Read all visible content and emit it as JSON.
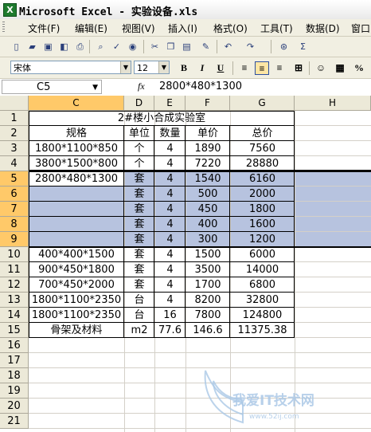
{
  "window": {
    "title": "Microsoft Excel - 实验设备.xls",
    "app_icon": "excel-icon"
  },
  "menu": [
    "文件(F)",
    "编辑(E)",
    "视图(V)",
    "插入(I)",
    "格式(O)",
    "工具(T)",
    "数据(D)",
    "窗口"
  ],
  "toolbar_icons": [
    "new-icon",
    "open-icon",
    "save-icon",
    "permission-icon",
    "print-icon",
    "print-preview-icon",
    "spelling-icon",
    "research-icon",
    "cut-icon",
    "copy-icon",
    "paste-icon",
    "format-painter-icon",
    "undo-icon",
    "redo-icon",
    "hyperlink-icon",
    "autosum-icon"
  ],
  "format_bar": {
    "font": "宋体",
    "size": "12",
    "bold": "B",
    "italic": "I",
    "underline": "U",
    "currency": "%"
  },
  "formula_bar": {
    "name_box": "C5",
    "fx": "fx",
    "formula": "2800*480*1300"
  },
  "columns": [
    "C",
    "D",
    "E",
    "F",
    "G",
    "H"
  ],
  "selected_column": "C",
  "rows": [
    "1",
    "2",
    "3",
    "4",
    "5",
    "6",
    "7",
    "8",
    "9",
    "10",
    "11",
    "12",
    "13",
    "14",
    "15",
    "16",
    "17",
    "18",
    "19",
    "20",
    "21"
  ],
  "selected_rows": [
    "5",
    "6",
    "7",
    "8",
    "9"
  ],
  "sheet": {
    "title": "2#楼小合成实验室",
    "headers": [
      "规格",
      "单位",
      "数量",
      "单价",
      "总价"
    ],
    "body": [
      [
        "1800*1100*850",
        "个",
        "4",
        "1890",
        "7560"
      ],
      [
        "3800*1500*800",
        "个",
        "4",
        "7220",
        "28880"
      ],
      [
        "2800*480*1300",
        "套",
        "4",
        "1540",
        "6160"
      ],
      [
        "",
        "套",
        "4",
        "500",
        "2000"
      ],
      [
        "",
        "套",
        "4",
        "450",
        "1800"
      ],
      [
        "",
        "套",
        "4",
        "400",
        "1600"
      ],
      [
        "",
        "套",
        "4",
        "300",
        "1200"
      ],
      [
        "400*400*1500",
        "套",
        "4",
        "1500",
        "6000"
      ],
      [
        "900*450*1800",
        "套",
        "4",
        "3500",
        "14000"
      ],
      [
        "700*450*2000",
        "套",
        "4",
        "1700",
        "6800"
      ],
      [
        "1800*1100*2350",
        "台",
        "4",
        "8200",
        "32800"
      ],
      [
        "1800*1100*2350",
        "台",
        "16",
        "7800",
        "124800"
      ],
      [
        "骨架及材料",
        "m2",
        "77.6",
        "146.6",
        "11375.38"
      ]
    ]
  },
  "watermark": {
    "main": "我爱IT技术网",
    "sub": "www.52ij.com"
  }
}
